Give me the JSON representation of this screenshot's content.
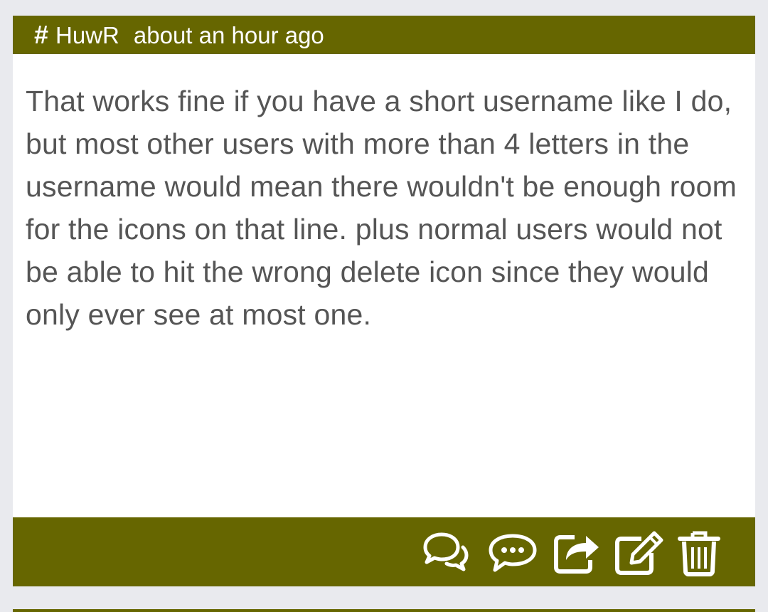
{
  "post": {
    "header": {
      "hash_icon": "#",
      "author": "HuwR",
      "timestamp": "about an hour ago"
    },
    "body": "That works fine if you have a short username like I do, but most other users with more than 4 letters in the username would mean there wouldn't be enough room for the icons on that line. plus normal users would not be able to hit the wrong delete icon since they would only ever see at most one.",
    "footer": {
      "actions": [
        {
          "name": "replies",
          "icon": "comments-icon"
        },
        {
          "name": "reply",
          "icon": "comment-dots-icon"
        },
        {
          "name": "share",
          "icon": "share-icon"
        },
        {
          "name": "edit",
          "icon": "edit-icon"
        },
        {
          "name": "delete",
          "icon": "trash-icon"
        }
      ]
    },
    "colors": {
      "accent": "#666600",
      "text": "#555555",
      "background": "#e9eaee",
      "card": "#ffffff"
    }
  }
}
